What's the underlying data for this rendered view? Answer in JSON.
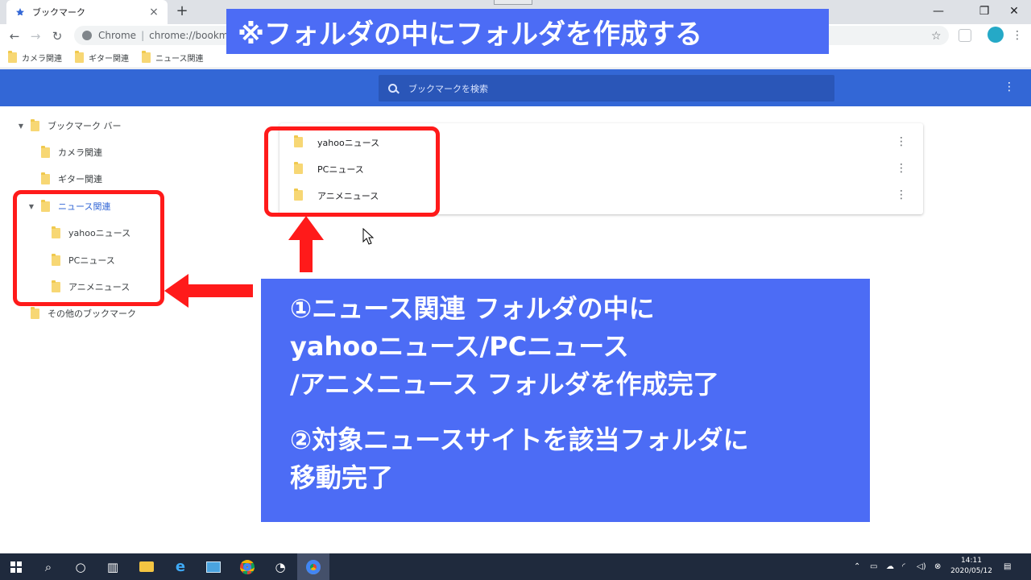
{
  "browser": {
    "tab_title": "ブックマーク",
    "omnibox_site": "Chrome",
    "omnibox_url": "chrome://bookmarks",
    "bookmarks_bar": [
      "カメラ関連",
      "ギター関連",
      "ニュース関連"
    ]
  },
  "manager": {
    "title": "ブックマーク",
    "search_placeholder": "ブックマークを検索",
    "tree": {
      "root": "ブックマーク バー",
      "items": [
        "カメラ関連",
        "ギター関連",
        "ニュース関連"
      ],
      "subitems": [
        "yahooニュース",
        "PCニュース",
        "アニメニュース"
      ],
      "other": "その他のブックマーク"
    },
    "list": [
      "yahooニュース",
      "PCニュース",
      "アニメニュース"
    ]
  },
  "annotations": {
    "banner": "※フォルダの中にフォルダを作成する",
    "info_lines": [
      "①ニュース関連 フォルダの中に",
      "yahooニュース/PCニュース",
      "/アニメニュース フォルダを作成完了"
    ],
    "info_lines_2": [
      "②対象ニュースサイトを該当フォルダに",
      "移動完了"
    ]
  },
  "taskbar": {
    "time": "14:11",
    "date": "2020/05/12"
  },
  "colors": {
    "header_blue": "#3367d6",
    "annotation_blue": "#4c6cf5",
    "highlight_red": "#ff1a1a"
  }
}
